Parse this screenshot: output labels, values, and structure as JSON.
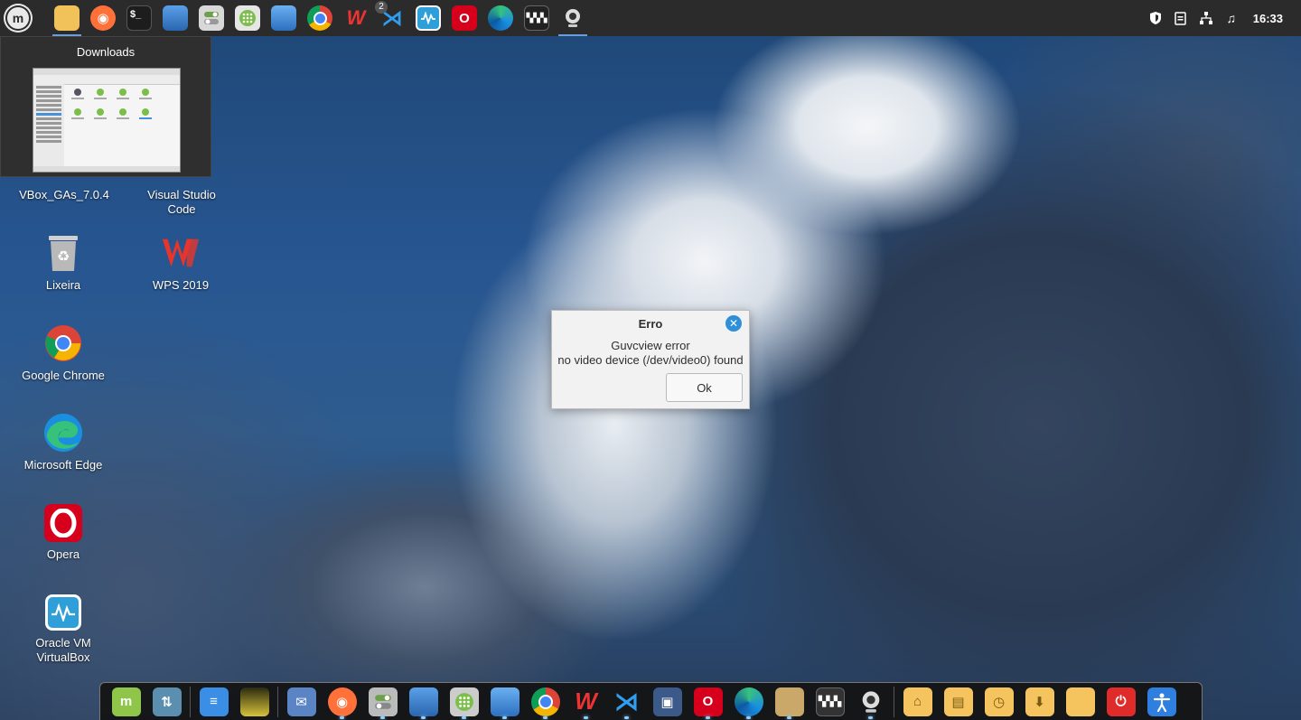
{
  "top_panel": {
    "clock": "16:33",
    "taskbar_badge": "2"
  },
  "preview": {
    "title": "Downloads"
  },
  "desktop": {
    "icons": [
      {
        "label": "VBox_GAs_7.0.4",
        "icon": "disc-icon"
      },
      {
        "label": "Visual Studio Code",
        "icon": "vscode-icon"
      },
      {
        "label": "Lixeira",
        "icon": "trash-icon"
      },
      {
        "label": "WPS 2019",
        "icon": "wps-icon"
      },
      {
        "label": "Google Chrome",
        "icon": "chrome-icon"
      },
      {
        "label": "Microsoft Edge",
        "icon": "edge-icon"
      },
      {
        "label": "Opera",
        "icon": "opera-icon"
      },
      {
        "label": "Oracle VM VirtualBox",
        "icon": "virtualbox-icon"
      }
    ]
  },
  "dialog": {
    "title": "Erro",
    "line1": "Guvcview error",
    "line2": "no video device (/dev/video0) found",
    "ok_label": "Ok"
  },
  "colors": {
    "accent": "#2f8fd8",
    "panel": "#2b2b2b",
    "opera_red": "#d6001c",
    "folder_yellow": "#f5c45e"
  }
}
